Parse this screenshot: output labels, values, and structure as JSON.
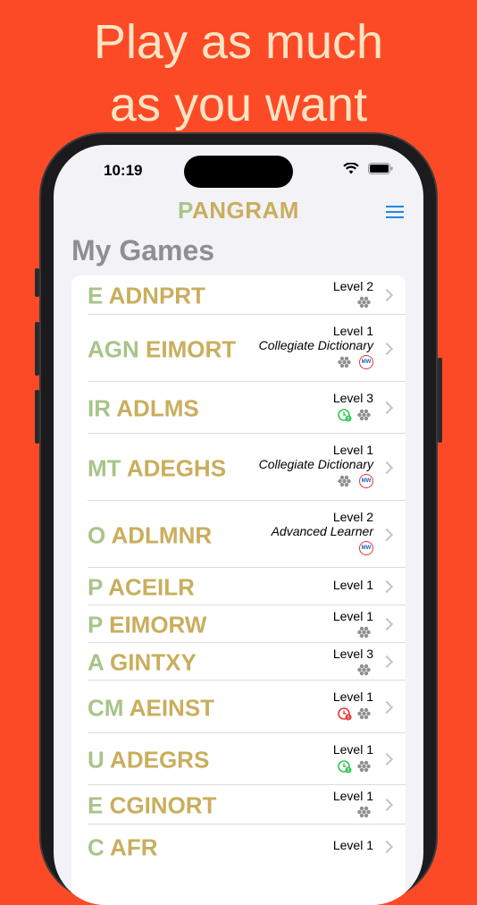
{
  "headline": {
    "line1": "Play as much",
    "line2": "as you want"
  },
  "status": {
    "time": "10:19"
  },
  "nav": {
    "title_center": "P",
    "title_rest": "ANGRAM",
    "menu_icon": "hamburger-menu-icon"
  },
  "section": {
    "title": "My Games"
  },
  "colors": {
    "background": "#fd4a26",
    "headline": "#fbe4c4",
    "center_letter": "#a8c48a",
    "ring_letters": "#c9ae5d",
    "accent": "#1e88e5"
  },
  "games": [
    {
      "center": "E",
      "rest": "ADNPRT",
      "level": "Level 2",
      "dictionary": "",
      "dots": true,
      "mw": false,
      "clock": ""
    },
    {
      "center": "AGN",
      "rest": "EIMORT",
      "level": "Level 1",
      "dictionary": "Collegiate Dictionary",
      "dots": true,
      "mw": true,
      "clock": ""
    },
    {
      "center": "IR",
      "rest": "ADLMS",
      "level": "Level 3",
      "dictionary": "",
      "dots": true,
      "mw": false,
      "clock": "green"
    },
    {
      "center": "MT",
      "rest": "ADEGHS",
      "level": "Level 1",
      "dictionary": "Collegiate Dictionary",
      "dots": true,
      "mw": true,
      "clock": ""
    },
    {
      "center": "O",
      "rest": "ADLMNR",
      "level": "Level 2",
      "dictionary": "Advanced Learner",
      "dots": false,
      "mw": true,
      "clock": ""
    },
    {
      "center": "P",
      "rest": "ACEILR",
      "level": "Level 1",
      "dictionary": "",
      "dots": false,
      "mw": false,
      "clock": ""
    },
    {
      "center": "P",
      "rest": "EIMORW",
      "level": "Level 1",
      "dictionary": "",
      "dots": true,
      "mw": false,
      "clock": ""
    },
    {
      "center": "A",
      "rest": "GINTXY",
      "level": "Level 3",
      "dictionary": "",
      "dots": true,
      "mw": false,
      "clock": ""
    },
    {
      "center": "CM",
      "rest": "AEINST",
      "level": "Level 1",
      "dictionary": "",
      "dots": true,
      "mw": false,
      "clock": "red"
    },
    {
      "center": "U",
      "rest": "ADEGRS",
      "level": "Level 1",
      "dictionary": "",
      "dots": true,
      "mw": false,
      "clock": "green"
    },
    {
      "center": "E",
      "rest": "CGINORT",
      "level": "Level 1",
      "dictionary": "",
      "dots": true,
      "mw": false,
      "clock": ""
    },
    {
      "center": "C",
      "rest": "AFR",
      "level": "Level 1",
      "dictionary": "",
      "dots": false,
      "mw": false,
      "clock": ""
    }
  ]
}
